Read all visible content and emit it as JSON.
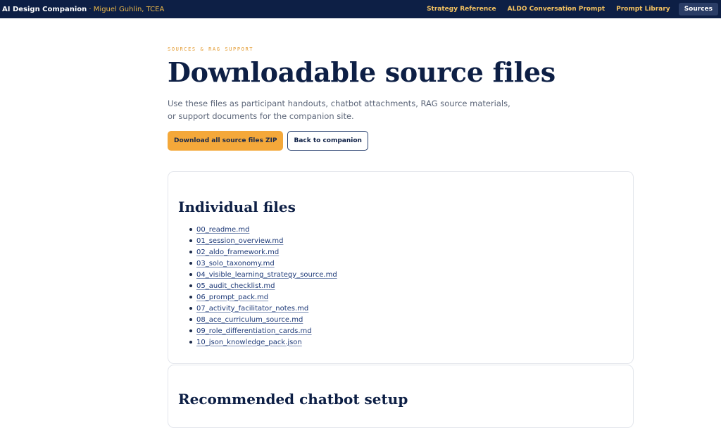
{
  "header": {
    "brand_title": "AI Design Companion",
    "brand_separator": " · ",
    "brand_author": "Miguel Guhlin, TCEA",
    "nav": [
      {
        "label": "Strategy Reference",
        "active": false
      },
      {
        "label": "ALDO Conversation Prompt",
        "active": false
      },
      {
        "label": "Prompt Library",
        "active": false
      },
      {
        "label": "Sources",
        "active": true
      }
    ]
  },
  "hero": {
    "eyebrow": "SOURCES & RAG SUPPORT",
    "title": "Downloadable source files",
    "lead": "Use these files as participant handouts, chatbot attachments, RAG source materials, or support documents for the companion site.",
    "primary_button": "Download all source files ZIP",
    "secondary_button": "Back to companion"
  },
  "files_card": {
    "heading": "Individual files",
    "files": [
      "00_readme.md",
      "01_session_overview.md",
      "02_aldo_framework.md",
      "03_solo_taxonomy.md",
      "04_visible_learning_strategy_source.md",
      "05_audit_checklist.md",
      "06_prompt_pack.md",
      "07_activity_facilitator_notes.md",
      "08_ace_curriculum_source.md",
      "09_role_differentiation_cards.md",
      "10_json_knowledge_pack.json"
    ]
  },
  "setup_card": {
    "heading": "Recommended chatbot setup"
  },
  "colors": {
    "header_bg": "#0d1f45",
    "accent": "#f4a83a",
    "link": "#1e3a78"
  }
}
